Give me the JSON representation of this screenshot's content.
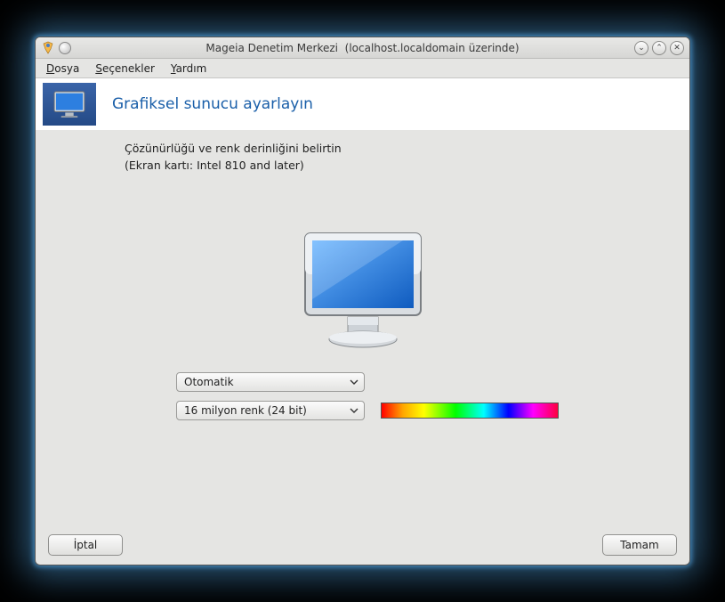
{
  "titlebar": {
    "app": "Mageia Denetim Merkezi",
    "host": "(localhost.localdomain üzerinde)",
    "buttons": {
      "min": "⌄",
      "max": "⌃",
      "close": "✕"
    }
  },
  "menu": {
    "items": [
      {
        "accel": "D",
        "rest": "osya"
      },
      {
        "accel": "S",
        "rest": "eçenekler"
      },
      {
        "accel": "Y",
        "rest": "ardım"
      }
    ]
  },
  "header": {
    "title": "Grafiksel sunucu ayarlayın"
  },
  "body": {
    "line1": "Çözünürlüğü ve renk derinliğini belirtin",
    "line2": "(Ekran kartı: Intel 810 and later)"
  },
  "controls": {
    "resolution": {
      "value": "Otomatik"
    },
    "color_depth": {
      "value": "16 milyon renk (24 bit)"
    }
  },
  "footer": {
    "cancel": "İptal",
    "ok": "Tamam"
  }
}
